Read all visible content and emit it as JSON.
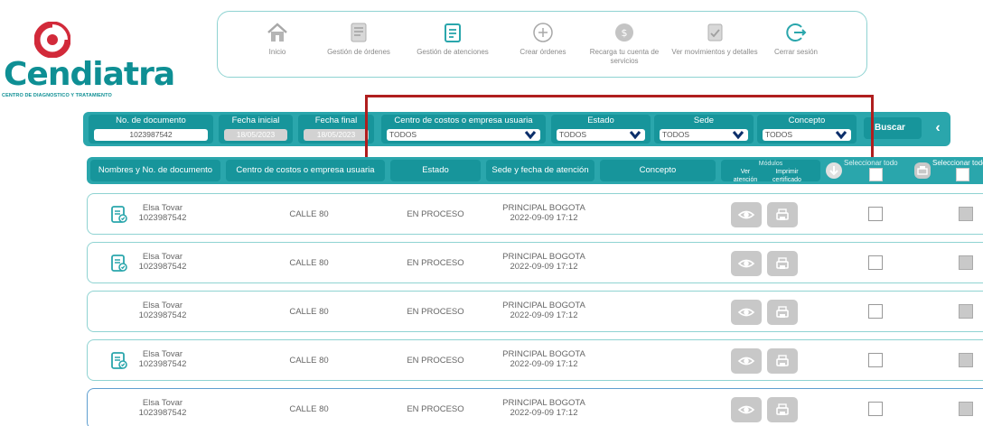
{
  "brand": {
    "name": "Cendiatra",
    "subtitle": "CENTRO DE DIAGNOSTICO Y TRATAMIENTO",
    "color": "#0e8f94"
  },
  "nav": {
    "items": [
      {
        "label": "Inicio",
        "icon": "home-icon"
      },
      {
        "label": "Gestión de órdenes",
        "icon": "orders-icon"
      },
      {
        "label": "Gestión de atenciones",
        "icon": "clipboard-icon"
      },
      {
        "label": "Crear órdenes",
        "icon": "plus-circle-icon"
      },
      {
        "label": "Recarga tu cuenta de servicios",
        "icon": "recharge-icon"
      },
      {
        "label": "Ver movimientos y detalles",
        "icon": "movements-icon"
      },
      {
        "label": "Cerrar sesión",
        "icon": "logout-icon"
      }
    ]
  },
  "filters": {
    "document_label": "No. de documento",
    "document_value": "1023987542",
    "start_label": "Fecha inicial",
    "start_value": "18/05/2023",
    "end_label": "Fecha final",
    "end_value": "18/05/2023",
    "cost_center_label": "Centro de costos o empresa usuaria",
    "cost_center_value": "TODOS",
    "state_label": "Estado",
    "state_value": "TODOS",
    "site_label": "Sede",
    "site_value": "TODOS",
    "concept_label": "Concepto",
    "concept_value": "TODOS",
    "search_label": "Buscar",
    "collapse_glyph": "‹"
  },
  "table": {
    "headers": {
      "name": "Nombres y No. de documento",
      "cost_center": "Centro de costos o empresa usuaria",
      "state": "Estado",
      "site": "Sede y fecha de atención",
      "concept": "Concepto",
      "modules": "Módulos",
      "view": "Ver atención",
      "print": "Imprimir certificado",
      "select_all_1": "Seleccionar todo",
      "select_all_2": "Seleccionar todo"
    },
    "rows": [
      {
        "name": "Elsa Tovar",
        "doc": "1023987542",
        "cost_center": "CALLE 80",
        "state": "EN PROCESO",
        "site": "PRINCIPAL BOGOTA",
        "date": "2022-09-09 17:12",
        "has_doc_icon": true
      },
      {
        "name": "Elsa Tovar",
        "doc": "1023987542",
        "cost_center": "CALLE 80",
        "state": "EN PROCESO",
        "site": "PRINCIPAL BOGOTA",
        "date": "2022-09-09 17:12",
        "has_doc_icon": true
      },
      {
        "name": "Elsa Tovar",
        "doc": "1023987542",
        "cost_center": "CALLE 80",
        "state": "EN PROCESO",
        "site": "PRINCIPAL BOGOTA",
        "date": "2022-09-09 17:12",
        "has_doc_icon": false
      },
      {
        "name": "Elsa Tovar",
        "doc": "1023987542",
        "cost_center": "CALLE 80",
        "state": "EN PROCESO",
        "site": "PRINCIPAL BOGOTA",
        "date": "2022-09-09 17:12",
        "has_doc_icon": true
      },
      {
        "name": "Elsa Tovar",
        "doc": "1023987542",
        "cost_center": "CALLE 80",
        "state": "EN PROCESO",
        "site": "PRINCIPAL BOGOTA",
        "date": "2022-09-09 17:12",
        "has_doc_icon": false
      }
    ]
  },
  "colors": {
    "teal": "#2aa6ac",
    "teal_dark": "#17959b",
    "highlight": "#b01e1e"
  }
}
